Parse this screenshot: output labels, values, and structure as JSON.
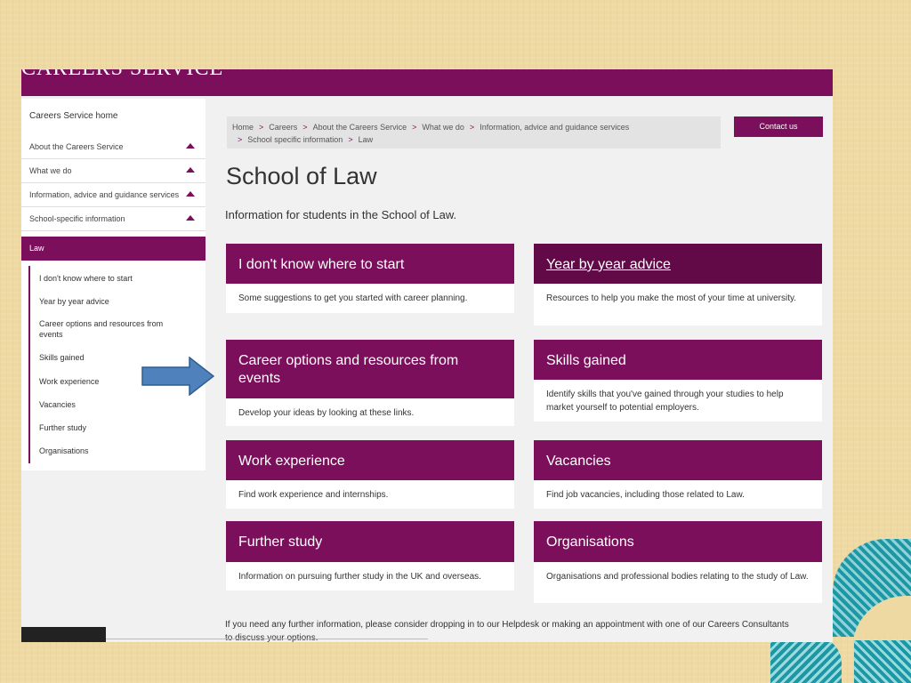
{
  "site": {
    "brand": "CAREERS SERVICE"
  },
  "leftnav": {
    "home": "Careers Service home",
    "items": [
      {
        "label": "About the Careers Service"
      },
      {
        "label": "What we do"
      },
      {
        "label": "Information, advice and guidance services"
      },
      {
        "label": "School-specific information"
      }
    ],
    "current": "Law",
    "subitems": [
      "I don't know where to start",
      "Year by year advice",
      "Career options and resources from events",
      "Skills gained",
      "Work experience",
      "Vacancies",
      "Further study",
      "Organisations"
    ]
  },
  "breadcrumb": [
    "Home",
    "Careers",
    "About the Careers Service",
    "What we do",
    "Information, advice and guidance services",
    "School specific information",
    "Law"
  ],
  "contact_label": "Contact us",
  "page": {
    "title": "School of Law",
    "lead": "Information for students in the School of Law."
  },
  "cards": [
    {
      "title": "I don't know where to start",
      "desc": "Some suggestions to get you started with career planning."
    },
    {
      "title": "Year by year advice",
      "desc": "Resources to help you make the most of your time at university."
    },
    {
      "title": "Career options and resources from events",
      "desc": "Develop your ideas by looking at these links."
    },
    {
      "title": "Skills gained",
      "desc": "Identify skills that you've gained through your studies to help market yourself to potential employers."
    },
    {
      "title": "Work experience",
      "desc": "Find work experience and internships."
    },
    {
      "title": "Vacancies",
      "desc": "Find job vacancies, including those related to Law."
    },
    {
      "title": "Further study",
      "desc": "Information on pursuing further study in the UK and overseas."
    },
    {
      "title": "Organisations",
      "desc": "Organisations and professional bodies relating to the study of Law."
    }
  ],
  "footer_text": "If you need any further information, please consider dropping in to our Helpdesk or making an appointment with one of our Careers Consultants to discuss your options.",
  "colors": {
    "brand": "#7c0f5b",
    "arrow": "#4f81bd",
    "decor": "#1d97a3"
  }
}
